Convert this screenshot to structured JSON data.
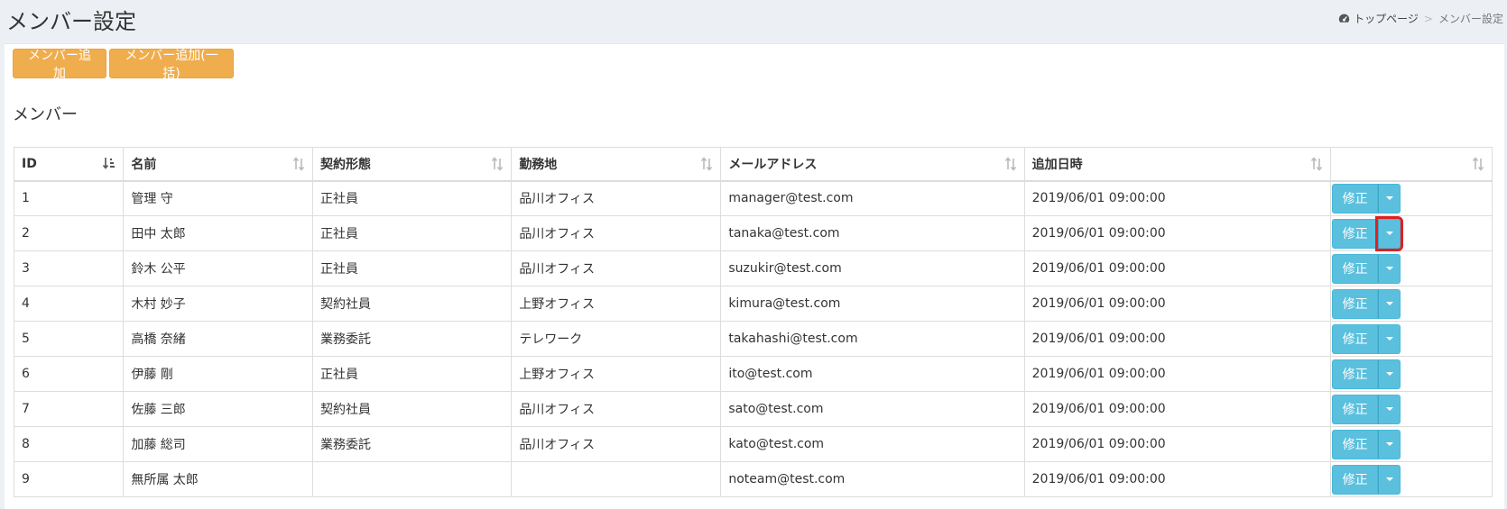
{
  "header": {
    "title": "メンバー設定",
    "breadcrumb": {
      "home": "トップページ",
      "separator": ">",
      "current": "メンバー設定"
    }
  },
  "toolbar": {
    "add_member": "メンバー追加",
    "add_member_bulk": "メンバー追加(一括)"
  },
  "section_title": "メンバー",
  "table": {
    "columns": [
      "ID",
      "名前",
      "契約形態",
      "勤務地",
      "メールアドレス",
      "追加日時",
      ""
    ],
    "rows": [
      [
        "1",
        "管理 守",
        "正社員",
        "品川オフィス",
        "manager@test.com",
        "2019/06/01 09:00:00"
      ],
      [
        "2",
        "田中 太郎",
        "正社員",
        "品川オフィス",
        "tanaka@test.com",
        "2019/06/01 09:00:00"
      ],
      [
        "3",
        "鈴木 公平",
        "正社員",
        "品川オフィス",
        "suzukir@test.com",
        "2019/06/01 09:00:00"
      ],
      [
        "4",
        "木村 妙子",
        "契約社員",
        "上野オフィス",
        "kimura@test.com",
        "2019/06/01 09:00:00"
      ],
      [
        "5",
        "高橋 奈緒",
        "業務委託",
        "テレワーク",
        "takahashi@test.com",
        "2019/06/01 09:00:00"
      ],
      [
        "6",
        "伊藤 剛",
        "正社員",
        "上野オフィス",
        "ito@test.com",
        "2019/06/01 09:00:00"
      ],
      [
        "7",
        "佐藤 三郎",
        "契約社員",
        "品川オフィス",
        "sato@test.com",
        "2019/06/01 09:00:00"
      ],
      [
        "8",
        "加藤 総司",
        "業務委託",
        "品川オフィス",
        "kato@test.com",
        "2019/06/01 09:00:00"
      ],
      [
        "9",
        "無所属 太郎",
        "",
        "",
        "noteam@test.com",
        "2019/06/01 09:00:00"
      ]
    ],
    "edit_label": "修正",
    "highlighted_row": 1
  },
  "colors": {
    "orange_button": "#f0ad4e",
    "info_button": "#5bc0de",
    "highlight": "#e02020",
    "page_bg": "#ecf0f5"
  },
  "icons": {
    "breadcrumb_home": "dashboard-icon",
    "sort": "sort-icon",
    "sort_active": "sort-numeric-asc-icon",
    "dropdown": "caret-down-icon"
  }
}
